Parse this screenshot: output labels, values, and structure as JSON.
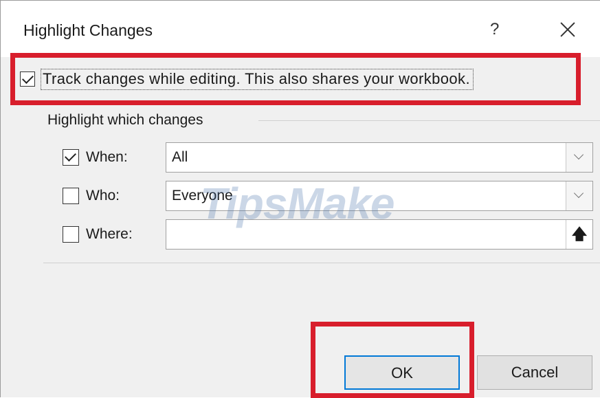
{
  "dialog": {
    "title": "Highlight Changes",
    "help_label": "?"
  },
  "track": {
    "label": "Track changes while editing. This also shares your workbook.",
    "checked": true
  },
  "group": {
    "title": "Highlight which changes",
    "rows": [
      {
        "label": "When:",
        "checked": true,
        "value": "All",
        "control": "dropdown"
      },
      {
        "label": "Who:",
        "checked": false,
        "value": "Everyone",
        "control": "dropdown"
      },
      {
        "label": "Where:",
        "checked": false,
        "value": "",
        "control": "range-selector"
      }
    ],
    "ref_button": "🡅"
  },
  "watermark": "TipsMake",
  "buttons": {
    "ok": "OK",
    "cancel": "Cancel"
  },
  "colors": {
    "highlight_box": "#d81e2c",
    "focus_border": "#0078d7"
  }
}
